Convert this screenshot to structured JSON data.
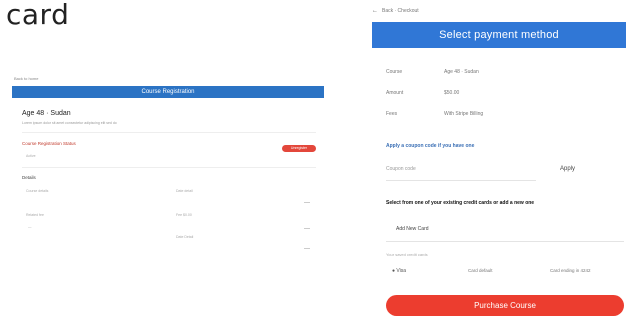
{
  "heading": "card",
  "left": {
    "back": "Back to home",
    "bar_title": "Course Registration",
    "course_title": "Age 48 · Sudan",
    "course_sub": "Lorem ipsum dolor sit amet consectetur adipiscing elit sed do",
    "reg_label": "Course Registration Status",
    "reg_value": "Active",
    "reg_badge": "Unregister",
    "details_label": "Details",
    "d1": "Course details",
    "d1v": "Date detail",
    "d2": "Related fee",
    "d2v": "Fee $0.00",
    "d3": "—",
    "d3v": "Date Detail"
  },
  "right": {
    "breadcrumb": "Back · Checkout",
    "header": "Select payment method",
    "rows": [
      {
        "label": "Course",
        "value": "Age 48 · Sudan"
      },
      {
        "label": "Amount",
        "value": "$50.00"
      },
      {
        "label": "Fees",
        "value": "With Stripe Billing"
      }
    ],
    "coupon_title": "Apply a coupon code if you have one",
    "coupon_label": "Coupon code",
    "apply": "Apply",
    "cc_title": "Select from one of your existing credit cards or add a new one",
    "add_card": "Add New Card",
    "your_cards": "Your saved credit cards",
    "card_a": "● Visa",
    "card_b": "Card default",
    "card_c": "Card ending in 4242",
    "purchase": "Purchase Course"
  },
  "colors": {
    "primary_blue": "#3077d6",
    "purchase_red": "#ec3d2f",
    "badge_red": "#e3473b"
  }
}
